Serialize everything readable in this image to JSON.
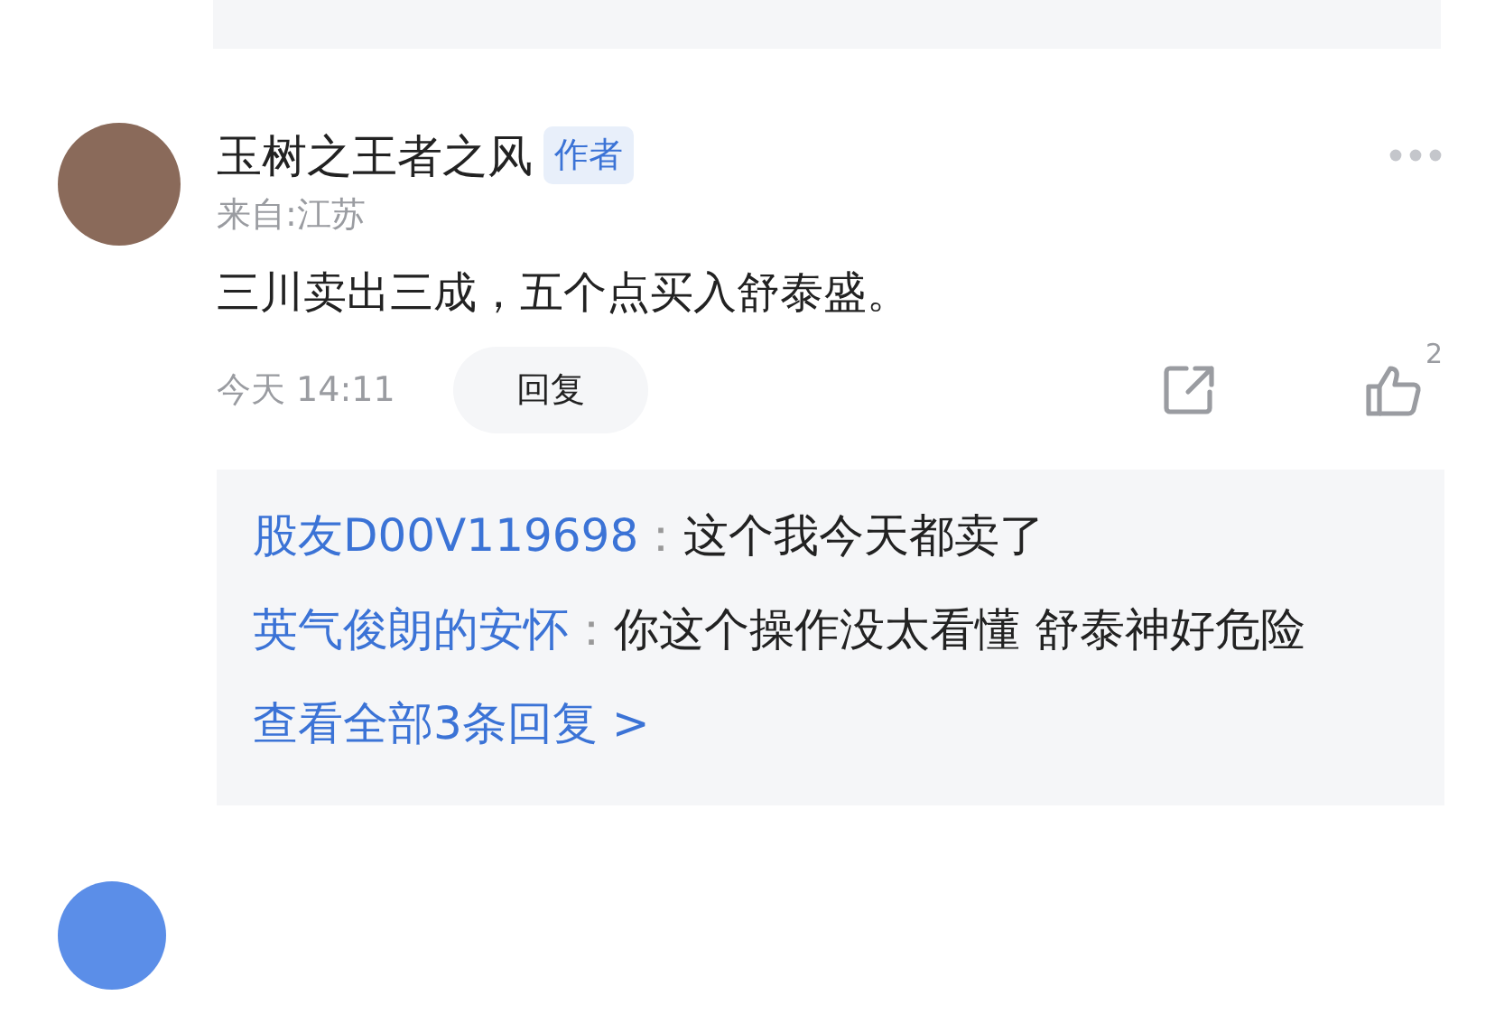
{
  "comment": {
    "author": "玉树之王者之风",
    "badge": "作者",
    "location": "来自:江苏",
    "content": "三川卖出三成，五个点买入舒泰盛。",
    "time": "今天 14:11",
    "reply_button": "回复",
    "likes": "2"
  },
  "replies": [
    {
      "user": "股友D00V119698",
      "separator": "：",
      "text": "这个我今天都卖了"
    },
    {
      "user": "英气俊朗的安怀",
      "separator": "：",
      "text": "你这个操作没太看懂 舒泰神好危险"
    }
  ],
  "view_all": "查看全部3条回复 >"
}
